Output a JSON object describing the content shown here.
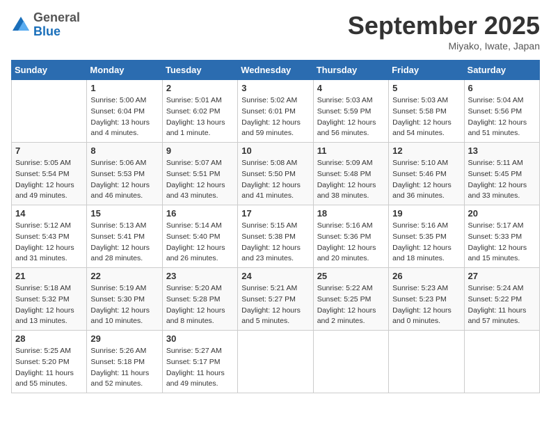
{
  "header": {
    "logo_general": "General",
    "logo_blue": "Blue",
    "month_title": "September 2025",
    "location": "Miyako, Iwate, Japan"
  },
  "weekdays": [
    "Sunday",
    "Monday",
    "Tuesday",
    "Wednesday",
    "Thursday",
    "Friday",
    "Saturday"
  ],
  "weeks": [
    [
      {
        "day": "",
        "info": ""
      },
      {
        "day": "1",
        "info": "Sunrise: 5:00 AM\nSunset: 6:04 PM\nDaylight: 13 hours\nand 4 minutes."
      },
      {
        "day": "2",
        "info": "Sunrise: 5:01 AM\nSunset: 6:02 PM\nDaylight: 13 hours\nand 1 minute."
      },
      {
        "day": "3",
        "info": "Sunrise: 5:02 AM\nSunset: 6:01 PM\nDaylight: 12 hours\nand 59 minutes."
      },
      {
        "day": "4",
        "info": "Sunrise: 5:03 AM\nSunset: 5:59 PM\nDaylight: 12 hours\nand 56 minutes."
      },
      {
        "day": "5",
        "info": "Sunrise: 5:03 AM\nSunset: 5:58 PM\nDaylight: 12 hours\nand 54 minutes."
      },
      {
        "day": "6",
        "info": "Sunrise: 5:04 AM\nSunset: 5:56 PM\nDaylight: 12 hours\nand 51 minutes."
      }
    ],
    [
      {
        "day": "7",
        "info": "Sunrise: 5:05 AM\nSunset: 5:54 PM\nDaylight: 12 hours\nand 49 minutes."
      },
      {
        "day": "8",
        "info": "Sunrise: 5:06 AM\nSunset: 5:53 PM\nDaylight: 12 hours\nand 46 minutes."
      },
      {
        "day": "9",
        "info": "Sunrise: 5:07 AM\nSunset: 5:51 PM\nDaylight: 12 hours\nand 43 minutes."
      },
      {
        "day": "10",
        "info": "Sunrise: 5:08 AM\nSunset: 5:50 PM\nDaylight: 12 hours\nand 41 minutes."
      },
      {
        "day": "11",
        "info": "Sunrise: 5:09 AM\nSunset: 5:48 PM\nDaylight: 12 hours\nand 38 minutes."
      },
      {
        "day": "12",
        "info": "Sunrise: 5:10 AM\nSunset: 5:46 PM\nDaylight: 12 hours\nand 36 minutes."
      },
      {
        "day": "13",
        "info": "Sunrise: 5:11 AM\nSunset: 5:45 PM\nDaylight: 12 hours\nand 33 minutes."
      }
    ],
    [
      {
        "day": "14",
        "info": "Sunrise: 5:12 AM\nSunset: 5:43 PM\nDaylight: 12 hours\nand 31 minutes."
      },
      {
        "day": "15",
        "info": "Sunrise: 5:13 AM\nSunset: 5:41 PM\nDaylight: 12 hours\nand 28 minutes."
      },
      {
        "day": "16",
        "info": "Sunrise: 5:14 AM\nSunset: 5:40 PM\nDaylight: 12 hours\nand 26 minutes."
      },
      {
        "day": "17",
        "info": "Sunrise: 5:15 AM\nSunset: 5:38 PM\nDaylight: 12 hours\nand 23 minutes."
      },
      {
        "day": "18",
        "info": "Sunrise: 5:16 AM\nSunset: 5:36 PM\nDaylight: 12 hours\nand 20 minutes."
      },
      {
        "day": "19",
        "info": "Sunrise: 5:16 AM\nSunset: 5:35 PM\nDaylight: 12 hours\nand 18 minutes."
      },
      {
        "day": "20",
        "info": "Sunrise: 5:17 AM\nSunset: 5:33 PM\nDaylight: 12 hours\nand 15 minutes."
      }
    ],
    [
      {
        "day": "21",
        "info": "Sunrise: 5:18 AM\nSunset: 5:32 PM\nDaylight: 12 hours\nand 13 minutes."
      },
      {
        "day": "22",
        "info": "Sunrise: 5:19 AM\nSunset: 5:30 PM\nDaylight: 12 hours\nand 10 minutes."
      },
      {
        "day": "23",
        "info": "Sunrise: 5:20 AM\nSunset: 5:28 PM\nDaylight: 12 hours\nand 8 minutes."
      },
      {
        "day": "24",
        "info": "Sunrise: 5:21 AM\nSunset: 5:27 PM\nDaylight: 12 hours\nand 5 minutes."
      },
      {
        "day": "25",
        "info": "Sunrise: 5:22 AM\nSunset: 5:25 PM\nDaylight: 12 hours\nand 2 minutes."
      },
      {
        "day": "26",
        "info": "Sunrise: 5:23 AM\nSunset: 5:23 PM\nDaylight: 12 hours\nand 0 minutes."
      },
      {
        "day": "27",
        "info": "Sunrise: 5:24 AM\nSunset: 5:22 PM\nDaylight: 11 hours\nand 57 minutes."
      }
    ],
    [
      {
        "day": "28",
        "info": "Sunrise: 5:25 AM\nSunset: 5:20 PM\nDaylight: 11 hours\nand 55 minutes."
      },
      {
        "day": "29",
        "info": "Sunrise: 5:26 AM\nSunset: 5:18 PM\nDaylight: 11 hours\nand 52 minutes."
      },
      {
        "day": "30",
        "info": "Sunrise: 5:27 AM\nSunset: 5:17 PM\nDaylight: 11 hours\nand 49 minutes."
      },
      {
        "day": "",
        "info": ""
      },
      {
        "day": "",
        "info": ""
      },
      {
        "day": "",
        "info": ""
      },
      {
        "day": "",
        "info": ""
      }
    ]
  ]
}
